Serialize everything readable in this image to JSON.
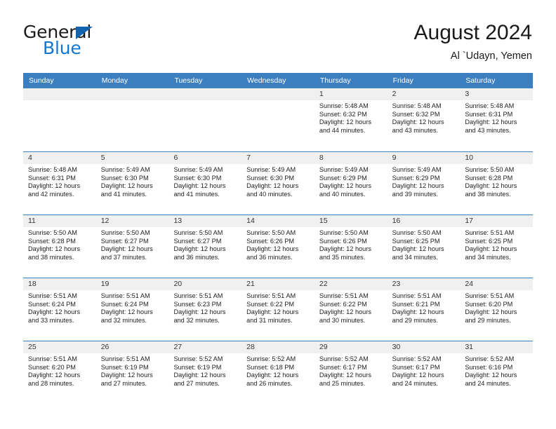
{
  "brand": {
    "word_general": "General",
    "word_blue": "Blue",
    "triangle_color": "#1263b0",
    "blue_color": "#1277cc"
  },
  "header": {
    "title": "August 2024",
    "subtitle": "Al `Udayn, Yemen"
  },
  "theme": {
    "header_band": "#3c7fc1",
    "date_band": "#f0f0f0",
    "row_divider": "#3c7fc1"
  },
  "weekdays": [
    "Sunday",
    "Monday",
    "Tuesday",
    "Wednesday",
    "Thursday",
    "Friday",
    "Saturday"
  ],
  "weeks": [
    [
      {
        "date": "",
        "sunrise": "",
        "sunset": "",
        "daylight": ""
      },
      {
        "date": "",
        "sunrise": "",
        "sunset": "",
        "daylight": ""
      },
      {
        "date": "",
        "sunrise": "",
        "sunset": "",
        "daylight": ""
      },
      {
        "date": "",
        "sunrise": "",
        "sunset": "",
        "daylight": ""
      },
      {
        "date": "1",
        "sunrise": "Sunrise: 5:48 AM",
        "sunset": "Sunset: 6:32 PM",
        "daylight": "Daylight: 12 hours and 44 minutes."
      },
      {
        "date": "2",
        "sunrise": "Sunrise: 5:48 AM",
        "sunset": "Sunset: 6:32 PM",
        "daylight": "Daylight: 12 hours and 43 minutes."
      },
      {
        "date": "3",
        "sunrise": "Sunrise: 5:48 AM",
        "sunset": "Sunset: 6:31 PM",
        "daylight": "Daylight: 12 hours and 43 minutes."
      }
    ],
    [
      {
        "date": "4",
        "sunrise": "Sunrise: 5:48 AM",
        "sunset": "Sunset: 6:31 PM",
        "daylight": "Daylight: 12 hours and 42 minutes."
      },
      {
        "date": "5",
        "sunrise": "Sunrise: 5:49 AM",
        "sunset": "Sunset: 6:30 PM",
        "daylight": "Daylight: 12 hours and 41 minutes."
      },
      {
        "date": "6",
        "sunrise": "Sunrise: 5:49 AM",
        "sunset": "Sunset: 6:30 PM",
        "daylight": "Daylight: 12 hours and 41 minutes."
      },
      {
        "date": "7",
        "sunrise": "Sunrise: 5:49 AM",
        "sunset": "Sunset: 6:30 PM",
        "daylight": "Daylight: 12 hours and 40 minutes."
      },
      {
        "date": "8",
        "sunrise": "Sunrise: 5:49 AM",
        "sunset": "Sunset: 6:29 PM",
        "daylight": "Daylight: 12 hours and 40 minutes."
      },
      {
        "date": "9",
        "sunrise": "Sunrise: 5:49 AM",
        "sunset": "Sunset: 6:29 PM",
        "daylight": "Daylight: 12 hours and 39 minutes."
      },
      {
        "date": "10",
        "sunrise": "Sunrise: 5:50 AM",
        "sunset": "Sunset: 6:28 PM",
        "daylight": "Daylight: 12 hours and 38 minutes."
      }
    ],
    [
      {
        "date": "11",
        "sunrise": "Sunrise: 5:50 AM",
        "sunset": "Sunset: 6:28 PM",
        "daylight": "Daylight: 12 hours and 38 minutes."
      },
      {
        "date": "12",
        "sunrise": "Sunrise: 5:50 AM",
        "sunset": "Sunset: 6:27 PM",
        "daylight": "Daylight: 12 hours and 37 minutes."
      },
      {
        "date": "13",
        "sunrise": "Sunrise: 5:50 AM",
        "sunset": "Sunset: 6:27 PM",
        "daylight": "Daylight: 12 hours and 36 minutes."
      },
      {
        "date": "14",
        "sunrise": "Sunrise: 5:50 AM",
        "sunset": "Sunset: 6:26 PM",
        "daylight": "Daylight: 12 hours and 36 minutes."
      },
      {
        "date": "15",
        "sunrise": "Sunrise: 5:50 AM",
        "sunset": "Sunset: 6:26 PM",
        "daylight": "Daylight: 12 hours and 35 minutes."
      },
      {
        "date": "16",
        "sunrise": "Sunrise: 5:50 AM",
        "sunset": "Sunset: 6:25 PM",
        "daylight": "Daylight: 12 hours and 34 minutes."
      },
      {
        "date": "17",
        "sunrise": "Sunrise: 5:51 AM",
        "sunset": "Sunset: 6:25 PM",
        "daylight": "Daylight: 12 hours and 34 minutes."
      }
    ],
    [
      {
        "date": "18",
        "sunrise": "Sunrise: 5:51 AM",
        "sunset": "Sunset: 6:24 PM",
        "daylight": "Daylight: 12 hours and 33 minutes."
      },
      {
        "date": "19",
        "sunrise": "Sunrise: 5:51 AM",
        "sunset": "Sunset: 6:24 PM",
        "daylight": "Daylight: 12 hours and 32 minutes."
      },
      {
        "date": "20",
        "sunrise": "Sunrise: 5:51 AM",
        "sunset": "Sunset: 6:23 PM",
        "daylight": "Daylight: 12 hours and 32 minutes."
      },
      {
        "date": "21",
        "sunrise": "Sunrise: 5:51 AM",
        "sunset": "Sunset: 6:22 PM",
        "daylight": "Daylight: 12 hours and 31 minutes."
      },
      {
        "date": "22",
        "sunrise": "Sunrise: 5:51 AM",
        "sunset": "Sunset: 6:22 PM",
        "daylight": "Daylight: 12 hours and 30 minutes."
      },
      {
        "date": "23",
        "sunrise": "Sunrise: 5:51 AM",
        "sunset": "Sunset: 6:21 PM",
        "daylight": "Daylight: 12 hours and 29 minutes."
      },
      {
        "date": "24",
        "sunrise": "Sunrise: 5:51 AM",
        "sunset": "Sunset: 6:20 PM",
        "daylight": "Daylight: 12 hours and 29 minutes."
      }
    ],
    [
      {
        "date": "25",
        "sunrise": "Sunrise: 5:51 AM",
        "sunset": "Sunset: 6:20 PM",
        "daylight": "Daylight: 12 hours and 28 minutes."
      },
      {
        "date": "26",
        "sunrise": "Sunrise: 5:51 AM",
        "sunset": "Sunset: 6:19 PM",
        "daylight": "Daylight: 12 hours and 27 minutes."
      },
      {
        "date": "27",
        "sunrise": "Sunrise: 5:52 AM",
        "sunset": "Sunset: 6:19 PM",
        "daylight": "Daylight: 12 hours and 27 minutes."
      },
      {
        "date": "28",
        "sunrise": "Sunrise: 5:52 AM",
        "sunset": "Sunset: 6:18 PM",
        "daylight": "Daylight: 12 hours and 26 minutes."
      },
      {
        "date": "29",
        "sunrise": "Sunrise: 5:52 AM",
        "sunset": "Sunset: 6:17 PM",
        "daylight": "Daylight: 12 hours and 25 minutes."
      },
      {
        "date": "30",
        "sunrise": "Sunrise: 5:52 AM",
        "sunset": "Sunset: 6:17 PM",
        "daylight": "Daylight: 12 hours and 24 minutes."
      },
      {
        "date": "31",
        "sunrise": "Sunrise: 5:52 AM",
        "sunset": "Sunset: 6:16 PM",
        "daylight": "Daylight: 12 hours and 24 minutes."
      }
    ]
  ]
}
